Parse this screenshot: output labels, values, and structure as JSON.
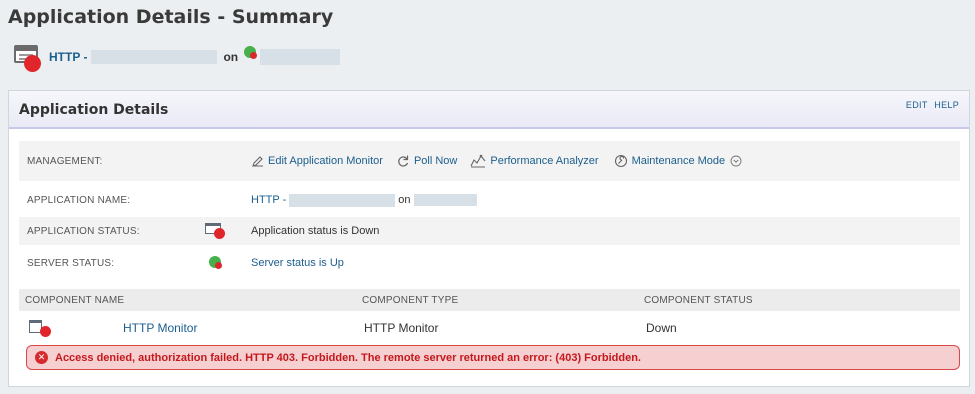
{
  "page": {
    "title": "Application Details - Summary"
  },
  "subheader": {
    "app_link": "HTTP -",
    "on_label": "on"
  },
  "panel": {
    "title": "Application Details",
    "edit_label": "EDIT",
    "help_label": "HELP"
  },
  "management": {
    "label": "MANAGEMENT:",
    "actions": {
      "edit": "Edit Application Monitor",
      "poll": "Poll Now",
      "perf": "Performance Analyzer",
      "maint": "Maintenance Mode"
    }
  },
  "app_name": {
    "label": "APPLICATION NAME:",
    "value_prefix": "HTTP -",
    "on_label": "on"
  },
  "app_status": {
    "label": "APPLICATION STATUS:",
    "value": "Application status is Down"
  },
  "server_status": {
    "label": "SERVER STATUS:",
    "value": "Server status is Up"
  },
  "components": {
    "headers": [
      "COMPONENT NAME",
      "COMPONENT TYPE",
      "COMPONENT STATUS"
    ],
    "rows": [
      {
        "name": "HTTP Monitor",
        "type": "HTTP Monitor",
        "status": "Down"
      }
    ]
  },
  "error": {
    "message": "Access denied, authorization failed. HTTP 403. Forbidden. The remote server returned an error: (403) Forbidden."
  },
  "colors": {
    "link": "#1b5e8d",
    "down": "#e0252b",
    "up": "#46b14a",
    "error_bg": "#f6d0d0",
    "error_text": "#c4181d"
  },
  "icons": [
    "application-down-icon",
    "server-up-icon",
    "pencil-icon",
    "refresh-icon",
    "performance-analyzer-icon",
    "maintenance-icon",
    "chevron-down-icon",
    "component-down-icon",
    "error-icon"
  ]
}
